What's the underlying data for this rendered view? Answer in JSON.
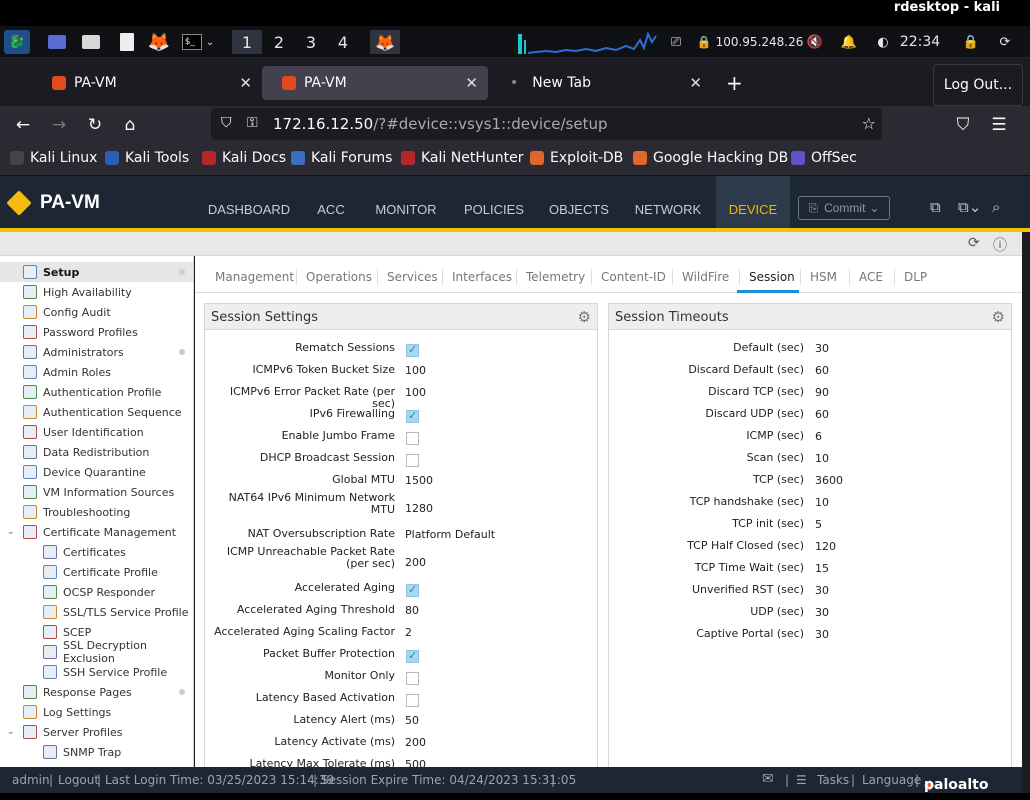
{
  "rdesktop_title": "rdesktop - kali",
  "panel": {
    "workspaces": [
      "1",
      "2",
      "3",
      "4"
    ],
    "ip": "100.95.248.26",
    "clock": "22:34"
  },
  "browser": {
    "tabs": [
      {
        "label": "PA-VM"
      },
      {
        "label": "PA-VM"
      },
      {
        "label": "New Tab"
      }
    ],
    "new_tab": "+",
    "tooltip": "Log Out...",
    "url_host": "172.16.12.50",
    "url_path": "/?#device::vsys1::device/setup",
    "bookmarks": [
      "Kali Linux",
      "Kali Tools",
      "Kali Docs",
      "Kali Forums",
      "Kali NetHunter",
      "Exploit-DB",
      "Google Hacking DB",
      "OffSec"
    ]
  },
  "app": {
    "logo": "PA-VM",
    "tabs": [
      "DASHBOARD",
      "ACC",
      "MONITOR",
      "POLICIES",
      "OBJECTS",
      "NETWORK",
      "DEVICE"
    ],
    "commit": "Commit"
  },
  "sidebar": [
    {
      "label": "Setup",
      "selected": true
    },
    {
      "label": "High Availability"
    },
    {
      "label": "Config Audit"
    },
    {
      "label": "Password Profiles"
    },
    {
      "label": "Administrators"
    },
    {
      "label": "Admin Roles"
    },
    {
      "label": "Authentication Profile"
    },
    {
      "label": "Authentication Sequence"
    },
    {
      "label": "User Identification"
    },
    {
      "label": "Data Redistribution"
    },
    {
      "label": "Device Quarantine"
    },
    {
      "label": "VM Information Sources"
    },
    {
      "label": "Troubleshooting"
    },
    {
      "label": "Certificate Management"
    },
    {
      "label": "Certificates"
    },
    {
      "label": "Certificate Profile"
    },
    {
      "label": "OCSP Responder"
    },
    {
      "label": "SSL/TLS Service Profile"
    },
    {
      "label": "SCEP"
    },
    {
      "label": "SSL Decryption Exclusion"
    },
    {
      "label": "SSH Service Profile"
    },
    {
      "label": "Response Pages"
    },
    {
      "label": "Log Settings"
    },
    {
      "label": "Server Profiles"
    },
    {
      "label": "SNMP Trap"
    }
  ],
  "subtabs": [
    "Management",
    "Operations",
    "Services",
    "Interfaces",
    "Telemetry",
    "Content-ID",
    "WildFire",
    "Session",
    "HSM",
    "ACE",
    "DLP"
  ],
  "session_settings": {
    "title": "Session Settings",
    "rows": [
      {
        "label": "Rematch Sessions",
        "type": "check",
        "checked": true
      },
      {
        "label": "ICMPv6 Token Bucket Size",
        "value": "100"
      },
      {
        "label": "ICMPv6 Error Packet Rate (per sec)",
        "value": "100"
      },
      {
        "label": "IPv6 Firewalling",
        "type": "check",
        "checked": true
      },
      {
        "label": "Enable Jumbo Frame",
        "type": "check",
        "checked": false
      },
      {
        "label": "DHCP Broadcast Session",
        "type": "check",
        "checked": false
      },
      {
        "label": "Global MTU",
        "value": "1500"
      },
      {
        "label": "NAT64 IPv6 Minimum Network MTU",
        "value": "1280",
        "two_line": true
      },
      {
        "label": "NAT Oversubscription Rate",
        "value": "Platform Default"
      },
      {
        "label": "ICMP Unreachable Packet Rate (per sec)",
        "value": "200",
        "two_line": true
      },
      {
        "label": "Accelerated Aging",
        "type": "check",
        "checked": true
      },
      {
        "label": "Accelerated Aging Threshold",
        "value": "80"
      },
      {
        "label": "Accelerated Aging Scaling Factor",
        "value": "2"
      },
      {
        "label": "Packet Buffer Protection",
        "type": "check",
        "checked": true
      },
      {
        "label": "Monitor Only",
        "type": "check",
        "checked": false
      },
      {
        "label": "Latency Based Activation",
        "type": "check",
        "checked": false
      },
      {
        "label": "Latency Alert (ms)",
        "value": "50"
      },
      {
        "label": "Latency Activate (ms)",
        "value": "200"
      },
      {
        "label": "Latency Max Tolerate (ms)",
        "value": "500"
      }
    ]
  },
  "session_timeouts": {
    "title": "Session Timeouts",
    "rows": [
      {
        "label": "Default (sec)",
        "value": "30"
      },
      {
        "label": "Discard Default (sec)",
        "value": "60"
      },
      {
        "label": "Discard TCP (sec)",
        "value": "90"
      },
      {
        "label": "Discard UDP (sec)",
        "value": "60"
      },
      {
        "label": "ICMP (sec)",
        "value": "6"
      },
      {
        "label": "Scan (sec)",
        "value": "10"
      },
      {
        "label": "TCP (sec)",
        "value": "3600"
      },
      {
        "label": "TCP handshake (sec)",
        "value": "10"
      },
      {
        "label": "TCP init (sec)",
        "value": "5"
      },
      {
        "label": "TCP Half Closed (sec)",
        "value": "120"
      },
      {
        "label": "TCP Time Wait (sec)",
        "value": "15"
      },
      {
        "label": "Unverified RST (sec)",
        "value": "30"
      },
      {
        "label": "UDP (sec)",
        "value": "30"
      },
      {
        "label": "Captive Portal (sec)",
        "value": "30"
      }
    ]
  },
  "footer": {
    "user": "admin",
    "logout": "Logout",
    "last_login": "Last Login Time: 03/25/2023 15:14:39",
    "expire": "Session Expire Time: 04/24/2023 15:31:05",
    "tasks": "Tasks",
    "language": "Language",
    "brand": "paloalto"
  }
}
